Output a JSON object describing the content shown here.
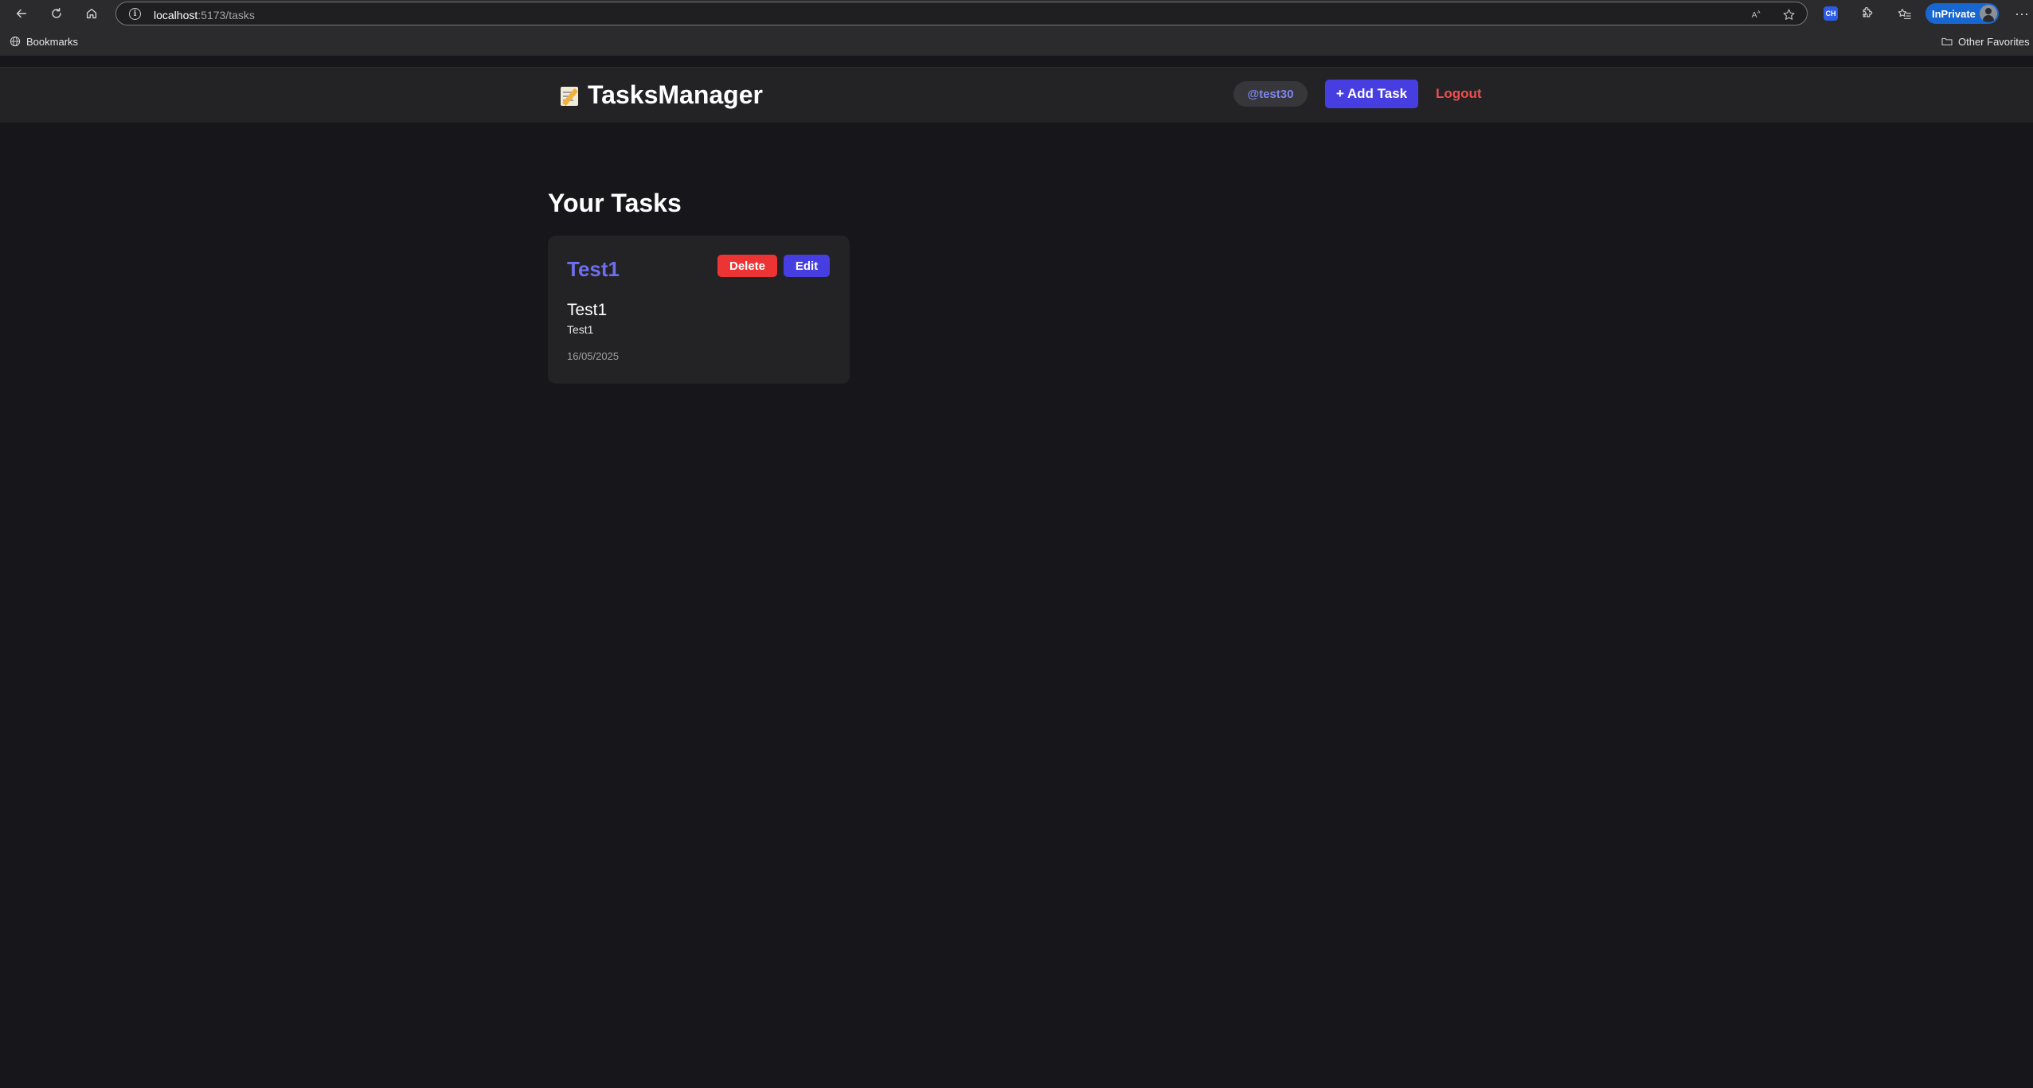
{
  "browser": {
    "url_host": "localhost",
    "url_path": ":5173/tasks",
    "inprivate_label": "InPrivate",
    "ext_badge": "CH",
    "bookmarks_label": "Bookmarks",
    "other_favorites_label": "Other Favorites"
  },
  "header": {
    "brand": "TasksManager",
    "username": "@test30",
    "add_task_label": "+ Add Task",
    "logout_label": "Logout"
  },
  "main": {
    "title": "Your Tasks",
    "tasks": [
      {
        "title": "Test1",
        "delete_label": "Delete",
        "edit_label": "Edit",
        "subtitle": "Test1",
        "description": "Test1",
        "date": "16/05/2025"
      }
    ]
  },
  "colors": {
    "accent": "#463ee0",
    "danger": "#ec3434",
    "task_title": "#6e6ef0",
    "background": "#17171b",
    "surface": "#232326"
  }
}
